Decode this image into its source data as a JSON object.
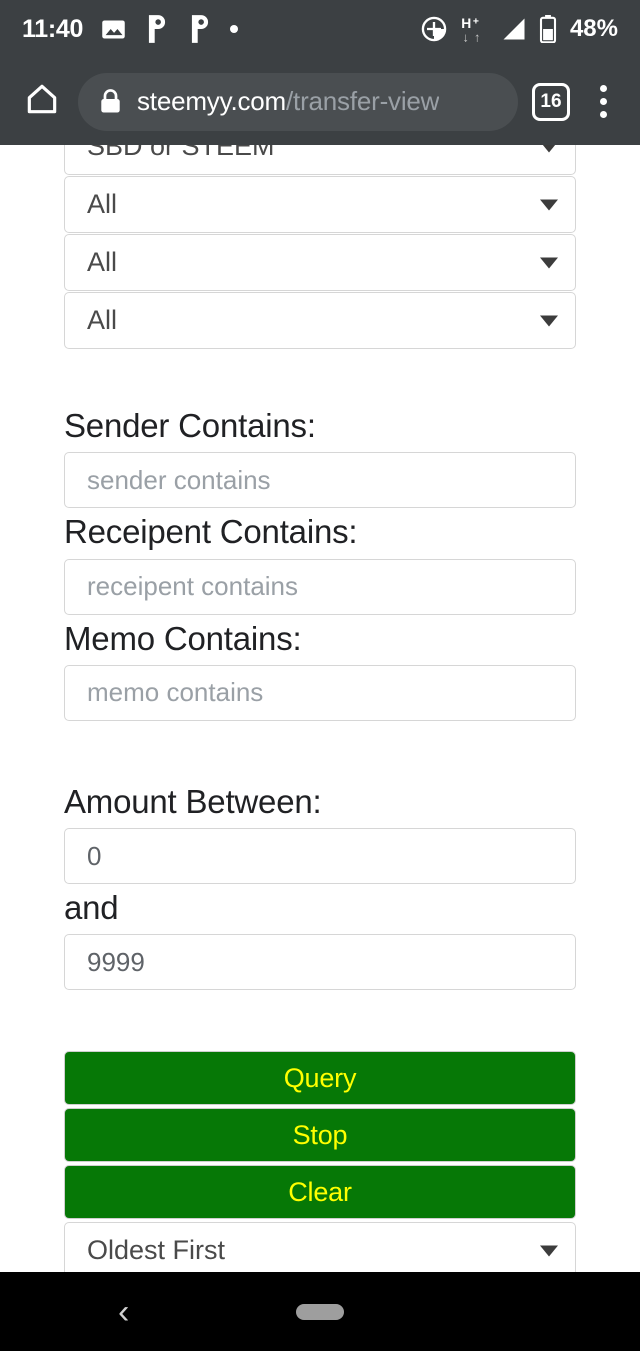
{
  "status_bar": {
    "time": "11:40",
    "battery_percent": "48%",
    "network_type": "H+",
    "icons": [
      "photo-icon",
      "p-app-icon",
      "p-app-icon",
      "dot-icon",
      "location-icon",
      "hplus-data-icon",
      "signal-icon",
      "battery-icon"
    ]
  },
  "browser": {
    "home_icon": "home-icon",
    "lock_icon": "lock-icon",
    "url_host": "steemyy.com",
    "url_path": "/transfer-view",
    "tab_count": "16",
    "menu_icon": "overflow-menu-icon"
  },
  "form": {
    "selects": [
      {
        "name": "currency-select",
        "value": "SBD or STEEM",
        "clipped": true
      },
      {
        "name": "filter-select-1",
        "value": "All",
        "clipped": false
      },
      {
        "name": "filter-select-2",
        "value": "All",
        "clipped": false
      },
      {
        "name": "filter-select-3",
        "value": "All",
        "clipped": false
      }
    ],
    "text_fields": [
      {
        "name": "sender-contains",
        "label": "Sender Contains:",
        "placeholder": "sender contains",
        "value": ""
      },
      {
        "name": "receipent-contains",
        "label": "Receipent Contains:",
        "placeholder": "receipent contains",
        "value": ""
      },
      {
        "name": "memo-contains",
        "label": "Memo Contains:",
        "placeholder": "memo contains",
        "value": ""
      }
    ],
    "amount": {
      "label": "Amount Between:",
      "min_value": "0",
      "conjunction": "and",
      "max_value": "9999"
    },
    "buttons": [
      {
        "name": "query-button",
        "label": "Query"
      },
      {
        "name": "stop-button",
        "label": "Stop"
      },
      {
        "name": "clear-button",
        "label": "Clear"
      }
    ],
    "sort_select": {
      "name": "sort-order-select",
      "value": "Oldest First"
    }
  },
  "nav_bar": {
    "back_glyph": "‹",
    "back_icon": "back-chevron-icon",
    "home_pill": "home-pill-icon"
  },
  "colors": {
    "toolbar_bg": "#3c4043",
    "button_green": "#067806",
    "button_text_yellow": "#ffff00",
    "nav_bar_bg": "#000000",
    "page_bg": "#ffffff"
  }
}
